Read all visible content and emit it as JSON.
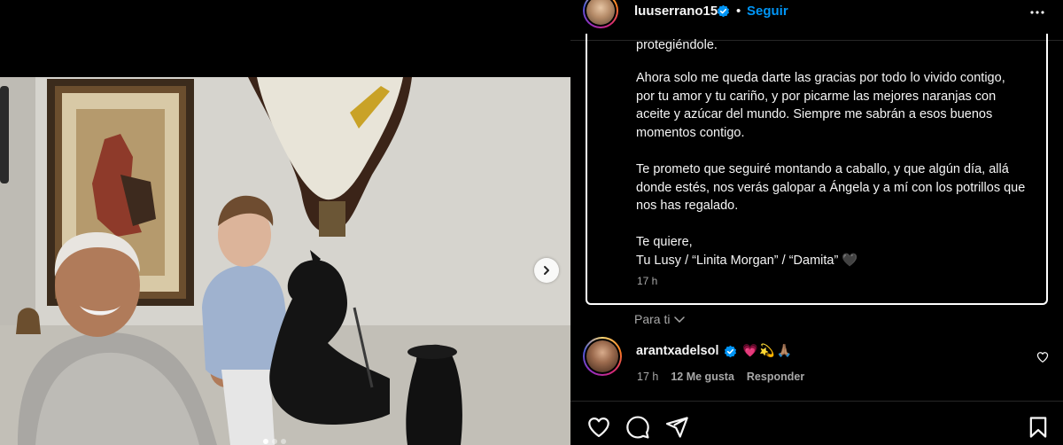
{
  "post": {
    "username": "luuserrano15",
    "separator": "•",
    "follow_label": "Seguir",
    "more_icon": "more-horizontal-icon"
  },
  "caption": {
    "clipped_line": "protegiéndole.",
    "paragraph_1": "Ahora solo me queda darte las gracias por todo lo vivido contigo,\npor tu amor y tu cariño, y por picarme las mejores naranjas con\naceite y azúcar del mundo. Siempre me sabrán a esos buenos\nmomentos contigo.",
    "paragraph_2": "Te prometo que seguiré montando a caballo, y que algún día, allá\ndonde estés, nos verás galopar a Ángela y a mí con los potrillos que\nnos has regalado.",
    "paragraph_3": "Te quiere,\nTu Lusy / “Linita Morgan” / “Damita” 🖤",
    "time": "17 h"
  },
  "for_you": {
    "label": "Para ti"
  },
  "comment": {
    "username": "arantxadelsol",
    "emojis": "💗💫🙏🏽",
    "time": "17 h",
    "likes": "12 Me gusta",
    "reply_label": "Responder"
  },
  "carousel": {
    "total_slides": 3,
    "active_slide": 1
  },
  "colors": {
    "background": "#000000",
    "link_blue": "#0095f6",
    "verified_blue": "#0095f6",
    "muted_text": "#a8a8a8"
  }
}
